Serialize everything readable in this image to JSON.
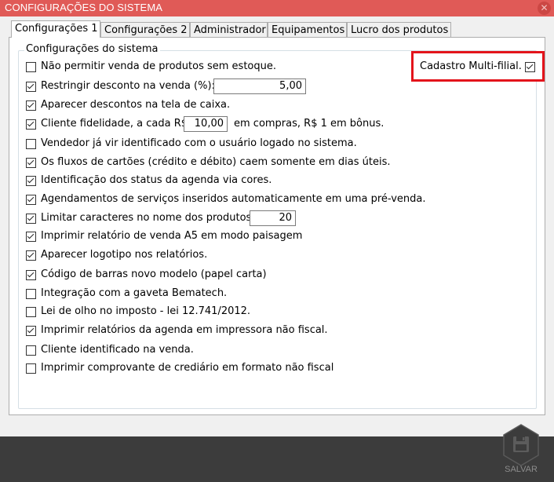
{
  "window": {
    "title": "CONFIGURAÇÕES DO SISTEMA",
    "close_glyph": "✕"
  },
  "tabs": [
    {
      "label": "Configurações 1"
    },
    {
      "label": "Configurações 2"
    },
    {
      "label": "Administrador"
    },
    {
      "label": "Equipamentos"
    },
    {
      "label": "Lucro dos produtos"
    }
  ],
  "group": {
    "title": "Configurações do sistema"
  },
  "settings": [
    {
      "label": "Não permitir venda de produtos sem estoque.",
      "checked": false
    },
    {
      "label": "Restringir desconto na venda (%):",
      "checked": true,
      "value": "5,00"
    },
    {
      "label": "Aparecer descontos na tela de caixa.",
      "checked": true
    },
    {
      "label": "Cliente fidelidade, a cada R$",
      "checked": true,
      "value": "10,00",
      "suffix": "em compras, R$ 1 em bônus."
    },
    {
      "label": "Vendedor já vir identificado com o usuário logado no sistema.",
      "checked": false
    },
    {
      "label": "Os fluxos de cartões (crédito e débito) caem somente em dias úteis.",
      "checked": true
    },
    {
      "label": "Identificação dos status da agenda via cores.",
      "checked": true
    },
    {
      "label": "Agendamentos de serviços inseridos automaticamente em uma pré-venda.",
      "checked": true
    },
    {
      "label": "Limitar caracteres no nome dos produtos:",
      "checked": true,
      "value": "20"
    },
    {
      "label": "Imprimir relatório de venda A5 em modo paisagem",
      "checked": true
    },
    {
      "label": "Aparecer logotipo nos relatórios.",
      "checked": true
    },
    {
      "label": "Código de barras novo modelo (papel carta)",
      "checked": true
    },
    {
      "label": "Integração com a gaveta Bematech.",
      "checked": false
    },
    {
      "label": "Lei de olho no imposto - lei 12.741/2012.",
      "checked": false
    },
    {
      "label": "Imprimir relatórios da agenda em impressora não fiscal.",
      "checked": true
    },
    {
      "label": "Cliente identificado na venda.",
      "checked": false
    },
    {
      "label": "Imprimir comprovante de crediário em formato não fiscal",
      "checked": false
    }
  ],
  "multi_filial": {
    "label": "Cadastro Multi-filial.",
    "checked": true
  },
  "footer": {
    "save_label": "SALVAR",
    "save_icon": "floppy-disk-icon"
  },
  "colors": {
    "title_bar": "#e05a57",
    "highlight_border": "#e3141b",
    "footer_bg": "#3c3c3c"
  }
}
